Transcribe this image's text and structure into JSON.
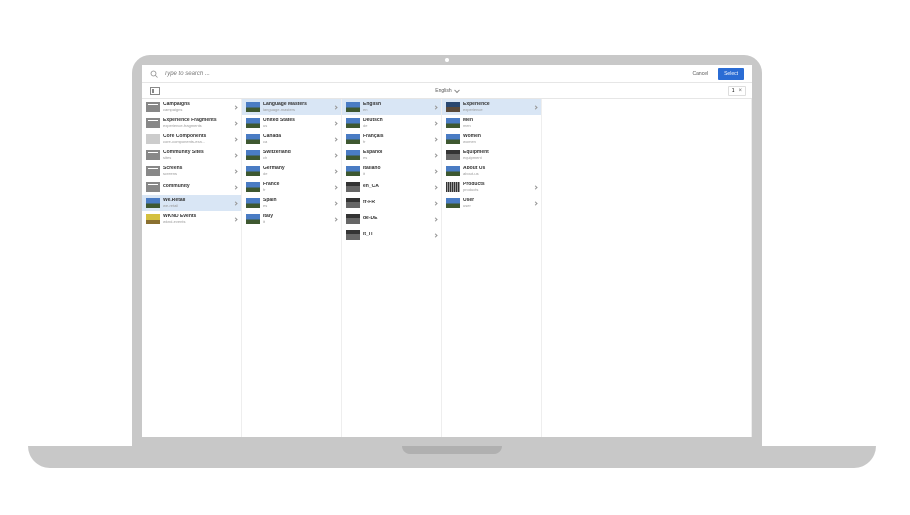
{
  "search": {
    "placeholder": "Type to search ..."
  },
  "actions": {
    "cancel": "Cancel",
    "select": "Select"
  },
  "toolbar": {
    "language": "English",
    "count": "1"
  },
  "columns": [
    [
      {
        "title": "Campaigns",
        "sub": "campaigns",
        "thumb": "fold",
        "sel": false,
        "arrow": true
      },
      {
        "title": "Experience Fragments",
        "sub": "experience-fragments",
        "thumb": "fold",
        "sel": false,
        "arrow": true
      },
      {
        "title": "Core Components",
        "sub": "core-components-exa...",
        "thumb": "box",
        "sel": false,
        "arrow": true
      },
      {
        "title": "Community Sites",
        "sub": "sites",
        "thumb": "fold",
        "sel": false,
        "arrow": true
      },
      {
        "title": "Screens",
        "sub": "screens",
        "thumb": "fold",
        "sel": false,
        "arrow": true
      },
      {
        "title": "community",
        "sub": "",
        "thumb": "fold",
        "sel": false,
        "arrow": true
      },
      {
        "title": "We.Retail",
        "sub": "we-retail",
        "thumb": "",
        "sel": true,
        "arrow": true
      },
      {
        "title": "WKND Events",
        "sub": "wknd-events",
        "thumb": "yel",
        "sel": false,
        "arrow": true
      }
    ],
    [
      {
        "title": "Language Masters",
        "sub": "language-masters",
        "thumb": "",
        "sel": true,
        "arrow": true
      },
      {
        "title": "United States",
        "sub": "us",
        "thumb": "",
        "sel": false,
        "arrow": true
      },
      {
        "title": "Canada",
        "sub": "ca",
        "thumb": "",
        "sel": false,
        "arrow": true
      },
      {
        "title": "Switzerland",
        "sub": "ch",
        "thumb": "",
        "sel": false,
        "arrow": true
      },
      {
        "title": "Germany",
        "sub": "de",
        "thumb": "",
        "sel": false,
        "arrow": true
      },
      {
        "title": "France",
        "sub": "fr",
        "thumb": "",
        "sel": false,
        "arrow": true
      },
      {
        "title": "Spain",
        "sub": "es",
        "thumb": "",
        "sel": false,
        "arrow": true
      },
      {
        "title": "Italy",
        "sub": "it",
        "thumb": "",
        "sel": false,
        "arrow": true
      }
    ],
    [
      {
        "title": "English",
        "sub": "en",
        "thumb": "",
        "sel": true,
        "arrow": true
      },
      {
        "title": "Deutsch",
        "sub": "de",
        "thumb": "",
        "sel": false,
        "arrow": true
      },
      {
        "title": "Français",
        "sub": "fr",
        "thumb": "",
        "sel": false,
        "arrow": true
      },
      {
        "title": "Español",
        "sub": "es",
        "thumb": "",
        "sel": false,
        "arrow": true
      },
      {
        "title": "Italiano",
        "sub": "it",
        "thumb": "",
        "sel": false,
        "arrow": true
      },
      {
        "title": "en_CA",
        "sub": "",
        "thumb": "dark",
        "sel": false,
        "arrow": true
      },
      {
        "title": "fr-FR",
        "sub": "",
        "thumb": "dark",
        "sel": false,
        "arrow": true
      },
      {
        "title": "de-DE",
        "sub": "",
        "thumb": "dark",
        "sel": false,
        "arrow": true
      },
      {
        "title": "it_IT",
        "sub": "",
        "thumb": "dark",
        "sel": false,
        "arrow": true
      }
    ],
    [
      {
        "title": "Experience",
        "sub": "experience",
        "thumb": "lady",
        "sel": true,
        "arrow": true
      },
      {
        "title": "Men",
        "sub": "men",
        "thumb": "",
        "sel": false,
        "arrow": false
      },
      {
        "title": "Women",
        "sub": "women",
        "thumb": "",
        "sel": false,
        "arrow": false
      },
      {
        "title": "Equipment",
        "sub": "equipment",
        "thumb": "dark",
        "sel": false,
        "arrow": false
      },
      {
        "title": "About Us",
        "sub": "about-us",
        "thumb": "",
        "sel": false,
        "arrow": false
      },
      {
        "title": "Products",
        "sub": "products",
        "thumb": "strip",
        "sel": false,
        "arrow": true
      },
      {
        "title": "User",
        "sub": "user",
        "thumb": "",
        "sel": false,
        "arrow": true
      }
    ]
  ]
}
